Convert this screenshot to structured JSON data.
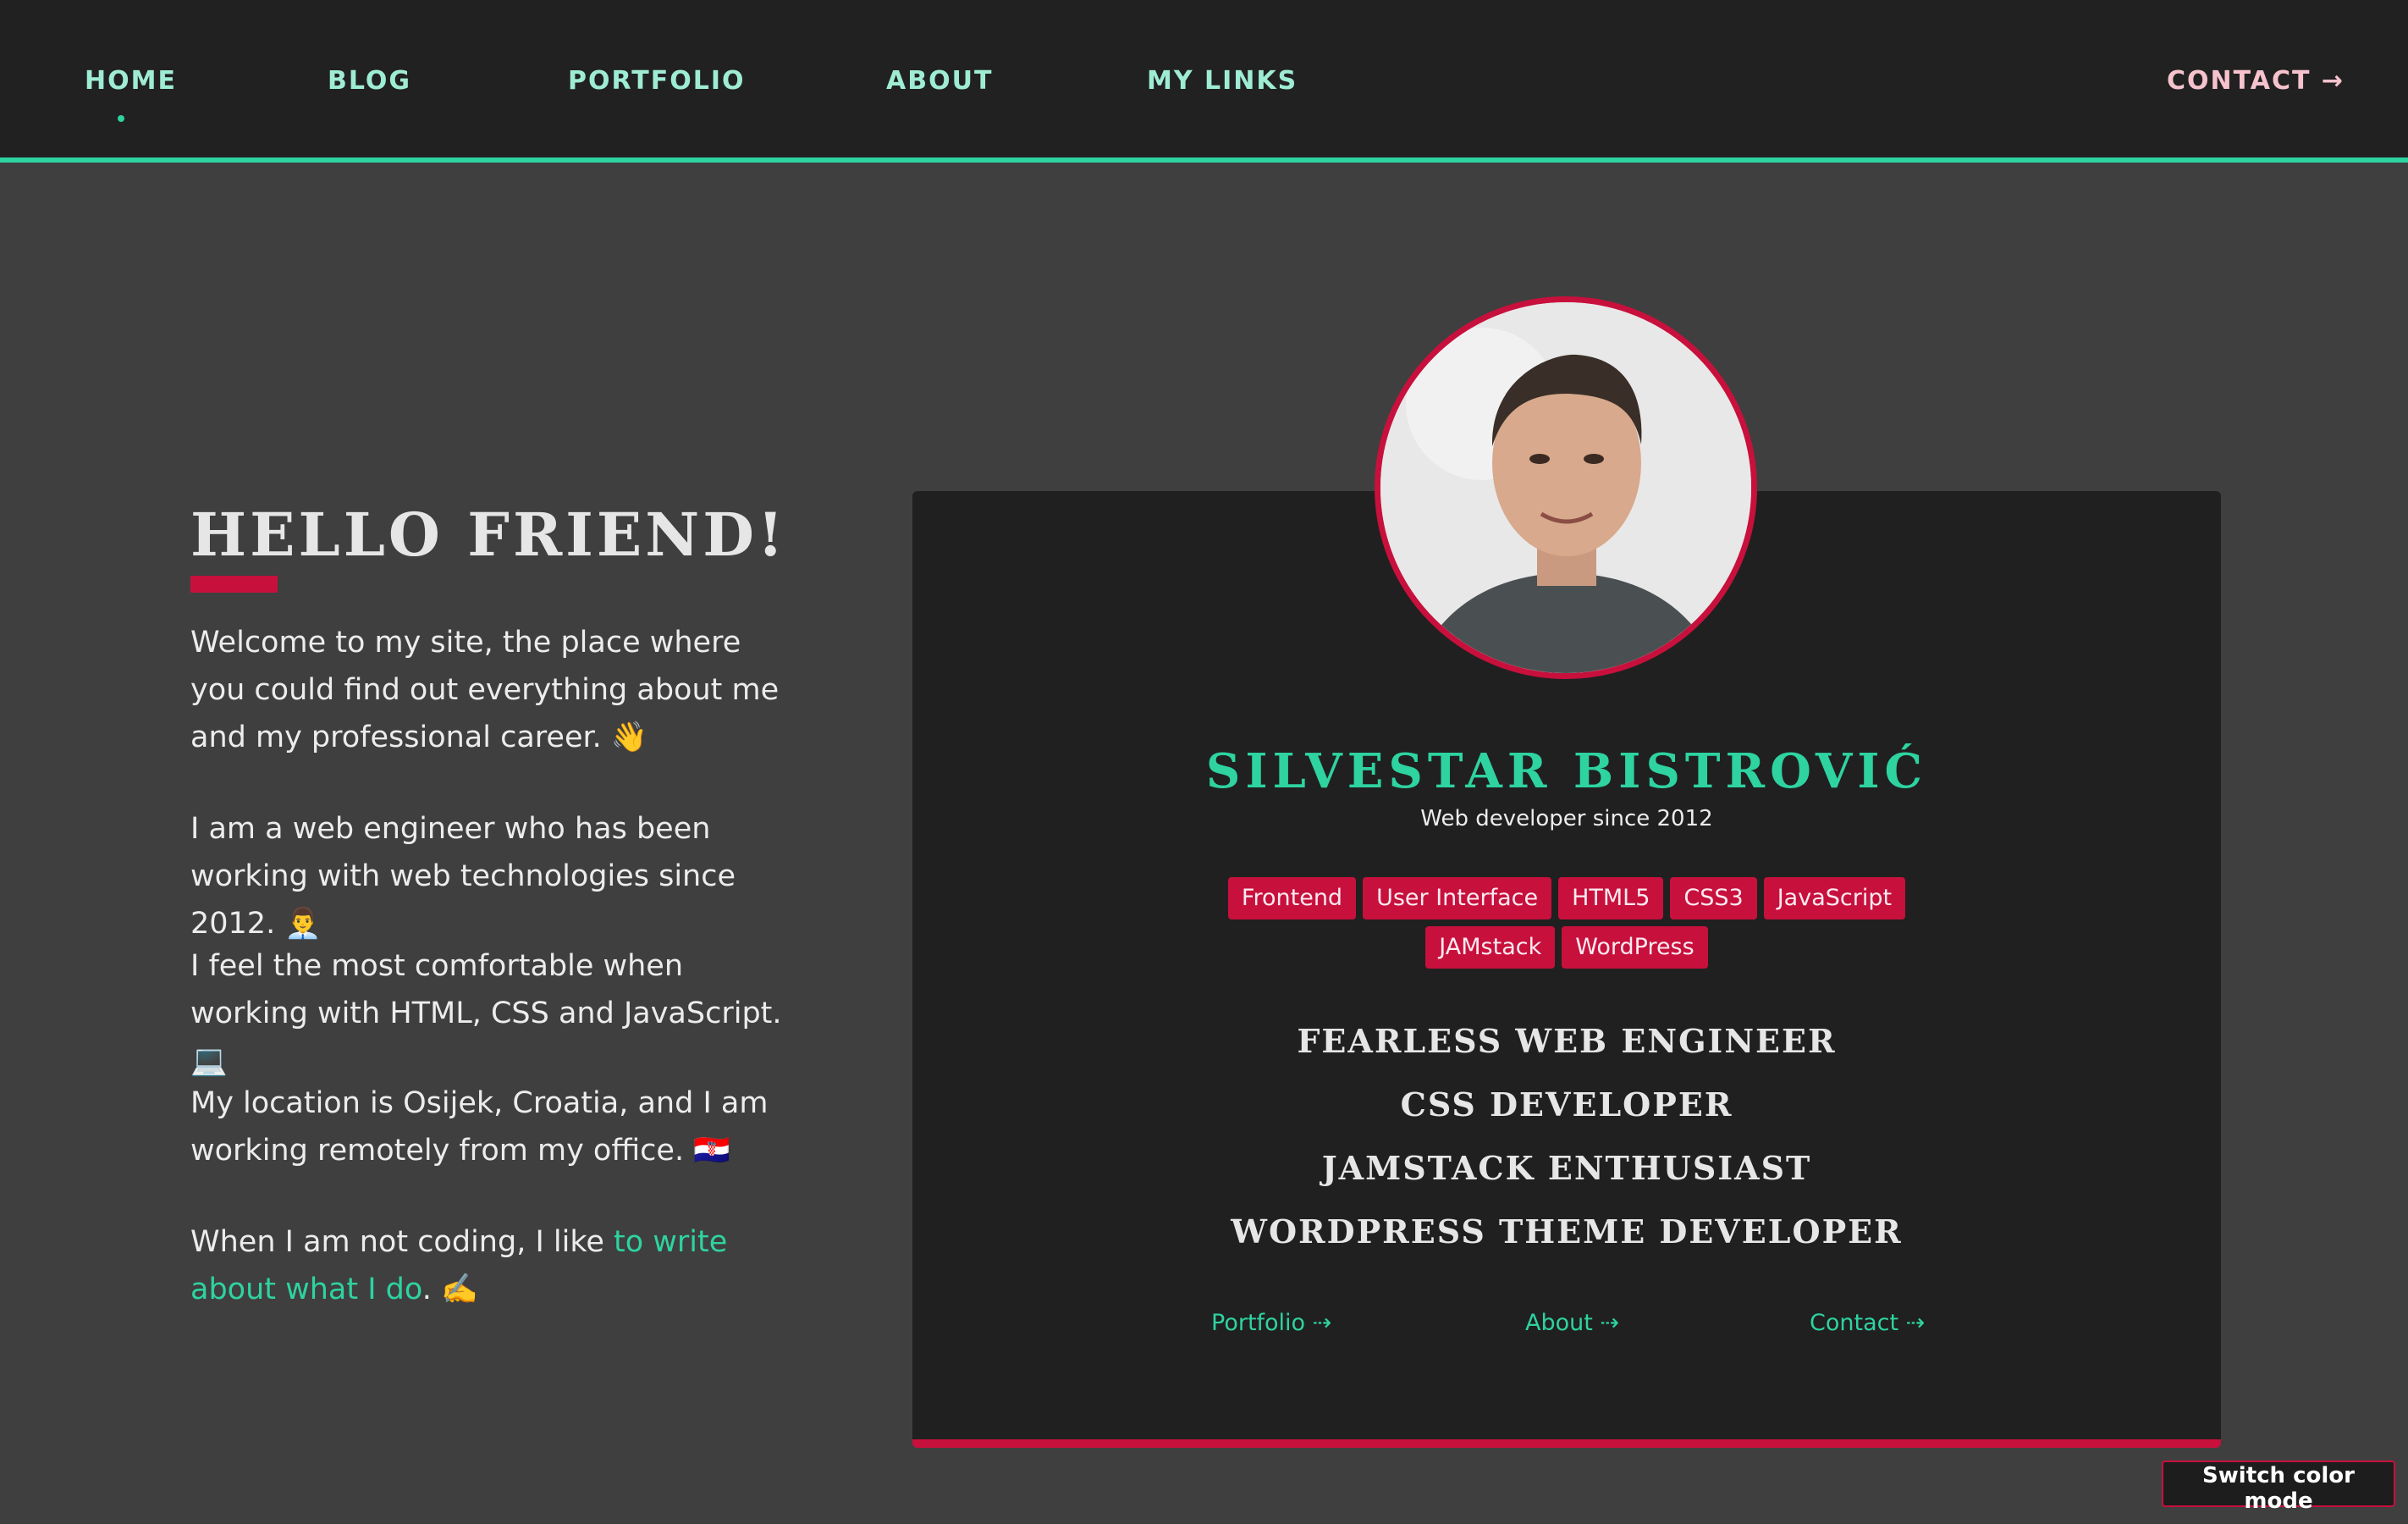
{
  "nav": {
    "items": [
      {
        "label": "HOME"
      },
      {
        "label": "BLOG"
      },
      {
        "label": "PORTFOLIO"
      },
      {
        "label": "ABOUT"
      },
      {
        "label": "MY LINKS"
      }
    ],
    "contact_label": "CONTACT →"
  },
  "intro": {
    "title": "HELLO FRIEND!",
    "paragraphs": [
      "Welcome to my site, the place where you could find out everything about me and my professional career. 👋",
      "I am a web engineer who has been working with web technologies since 2012. 👨‍💼",
      "I feel the most comfortable when working with HTML, CSS and JavaScript. 💻",
      "My location is Osijek, Croatia, and I am working remotely from my office. 🇭🇷"
    ],
    "last_prefix": "When I am not coding, I like ",
    "last_link": "to write about what I do",
    "last_suffix": ". ✍️"
  },
  "card": {
    "name": "SILVESTAR BISTROVIĆ",
    "subtitle": "Web developer since 2012",
    "tags": [
      "Frontend",
      "User Interface",
      "HTML5",
      "CSS3",
      "JavaScript",
      "JAMstack",
      "WordPress"
    ],
    "roles": [
      "Fearless web engineer",
      "CSS developer",
      "JAMstack enthusiast",
      "WordPress theme developer"
    ],
    "links": {
      "portfolio": "Portfolio ⇢",
      "about": "About ⇢",
      "contact": "Contact ⇢"
    }
  },
  "switch_label": "Switch color mode",
  "colors": {
    "accent": "#2ed3a0",
    "brand": "#c8103d",
    "background": "#3f3f3f",
    "card": "#202020"
  }
}
